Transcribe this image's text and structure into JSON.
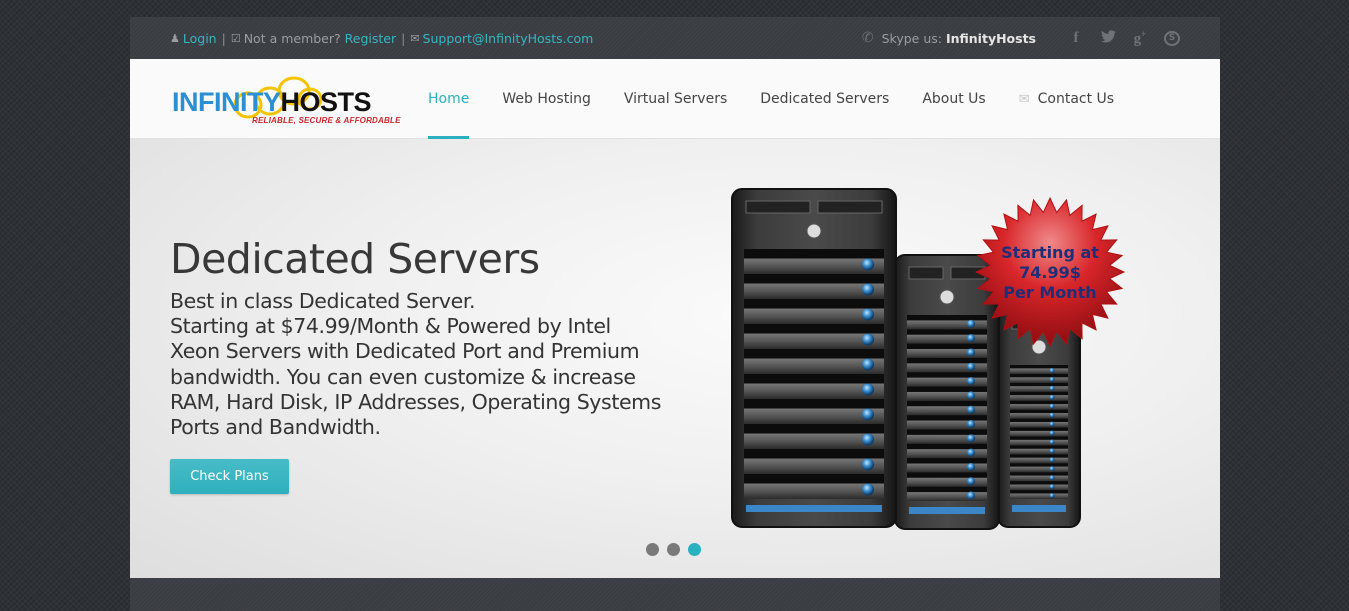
{
  "topbar": {
    "login_label": "Login",
    "not_member_text": "Not a member?",
    "register_label": "Register",
    "support_email": "Support@InfinityHosts.com",
    "skype_prefix": "Skype us:",
    "skype_name": "InfinityHosts",
    "social": [
      {
        "name": "facebook-icon",
        "glyph": "f"
      },
      {
        "name": "twitter-icon",
        "glyph": "t"
      },
      {
        "name": "google-plus-icon",
        "glyph": "g+"
      },
      {
        "name": "skype-icon",
        "glyph": "S"
      }
    ]
  },
  "logo": {
    "brand_part1": "INFINITY",
    "brand_part2": "HOSTS",
    "tagline": "RELIABLE, SECURE & AFFORDABLE"
  },
  "nav": {
    "items": [
      {
        "label": "Home",
        "active": true
      },
      {
        "label": "Web Hosting"
      },
      {
        "label": "Virtual Servers"
      },
      {
        "label": "Dedicated Servers"
      },
      {
        "label": "About Us"
      },
      {
        "label": "Contact Us",
        "icon": "envelope-icon"
      }
    ]
  },
  "hero": {
    "title": "Dedicated Servers",
    "lines": [
      "Best in class Dedicated Server.",
      "Starting at $74.99/Month & Powered by Intel",
      "Xeon Servers with Dedicated Port and Premium",
      "bandwidth. You can even customize & increase",
      "RAM, Hard Disk, IP Addresses, Operating Systems",
      "Ports and Bandwidth."
    ],
    "button_label": "Check Plans",
    "badge": {
      "line1": "Starting at",
      "line2": "74.99$",
      "line3": "Per Month"
    },
    "slides": {
      "count": 3,
      "active_index": 2
    }
  },
  "colors": {
    "accent": "#2bb0bf",
    "badge_red": "#c0171c",
    "badge_text": "#1e2f7a"
  }
}
